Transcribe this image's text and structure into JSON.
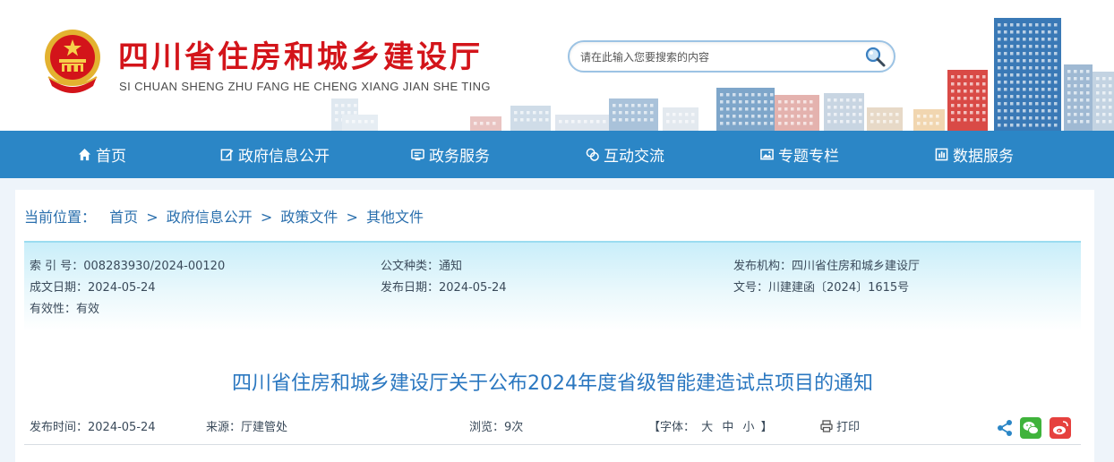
{
  "header": {
    "title": "四川省住房和城乡建设厅",
    "subtitle": "SI CHUAN SHENG ZHU FANG HE CHENG XIANG JIAN SHE TING",
    "search_placeholder": "请在此输入您要搜索的内容"
  },
  "nav": {
    "items": [
      {
        "label": "首页",
        "icon": "home-icon"
      },
      {
        "label": "政府信息公开",
        "icon": "edit-icon"
      },
      {
        "label": "政务服务",
        "icon": "service-icon"
      },
      {
        "label": "互动交流",
        "icon": "chat-icon"
      },
      {
        "label": "专题专栏",
        "icon": "image-icon"
      },
      {
        "label": "数据服务",
        "icon": "data-icon"
      }
    ]
  },
  "breadcrumb": {
    "prefix": "当前位置：",
    "items": [
      "首页",
      "政府信息公开",
      "政策文件",
      "其他文件"
    ],
    "separator": ">"
  },
  "meta": {
    "index_no": "索 引 号：008283930/2024-00120",
    "doc_type": "公文种类：通知",
    "publisher": "发布机构：四川省住房和城乡建设厅",
    "created": "成文日期：2024-05-24",
    "published": "发布日期：2024-05-24",
    "doc_no": "文号：川建建函〔2024〕1615号",
    "validity": "有效性：有效"
  },
  "article": {
    "title": "四川省住房和城乡建设厅关于公布2024年度省级智能建造试点项目的通知",
    "publish_time": "发布时间：2024-05-24",
    "source": "来源：厅建管处",
    "views": "浏览：9次",
    "font_size_label": "【字体：",
    "font_large": "大",
    "font_medium": "中",
    "font_small": "小",
    "font_close": "】",
    "print_label": "打印"
  },
  "colors": {
    "brand_red": "#d3141a",
    "nav_blue": "#2b86c6",
    "title_blue": "#2a77c0",
    "link_blue": "#2a6fad"
  }
}
